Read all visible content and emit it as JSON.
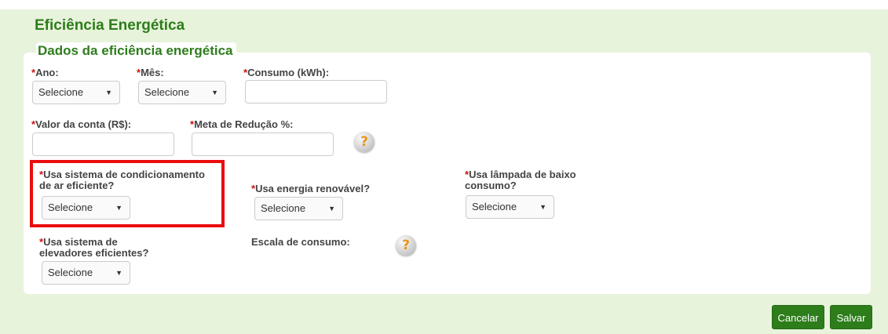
{
  "page": {
    "title": "Eficiência Energética",
    "section_title": "Dados da eficiência energética"
  },
  "required_marker": "*",
  "fields": {
    "ano": {
      "label": "Ano:",
      "value": "Selecione"
    },
    "mes": {
      "label": "Mês:",
      "value": "Selecione"
    },
    "consumo": {
      "label": "Consumo (kWh):",
      "value": ""
    },
    "valor_conta": {
      "label": "Valor da conta (R$):",
      "value": ""
    },
    "meta_reducao": {
      "label": "Meta de Redução %:",
      "value": ""
    },
    "condicionamento": {
      "label_line1": "Usa sistema de condicionamento",
      "label_line2": "de ar eficiente?",
      "value": "Selecione"
    },
    "energia_renovavel": {
      "label": "Usa energia renovável?",
      "value": "Selecione"
    },
    "lampada": {
      "label_line1": "Usa lâmpada de baixo",
      "label_line2": "consumo?",
      "value": "Selecione"
    },
    "elevadores": {
      "label_line1": "Usa sistema de",
      "label_line2": "elevadores eficientes?",
      "value": "Selecione"
    },
    "escala": {
      "label": "Escala de consumo:"
    }
  },
  "icons": {
    "help": "help-question-icon",
    "dropdown": "chevron-down-icon",
    "help_glyph": "?",
    "arrow_glyph": "▼"
  },
  "actions": {
    "cancel_label": "Cancelar",
    "save_label": "Salvar"
  },
  "colors": {
    "accent": "#2d7d1b",
    "panel_bg": "#e8f3dc",
    "required": "#d01010",
    "highlight": "#ea0c0c"
  }
}
